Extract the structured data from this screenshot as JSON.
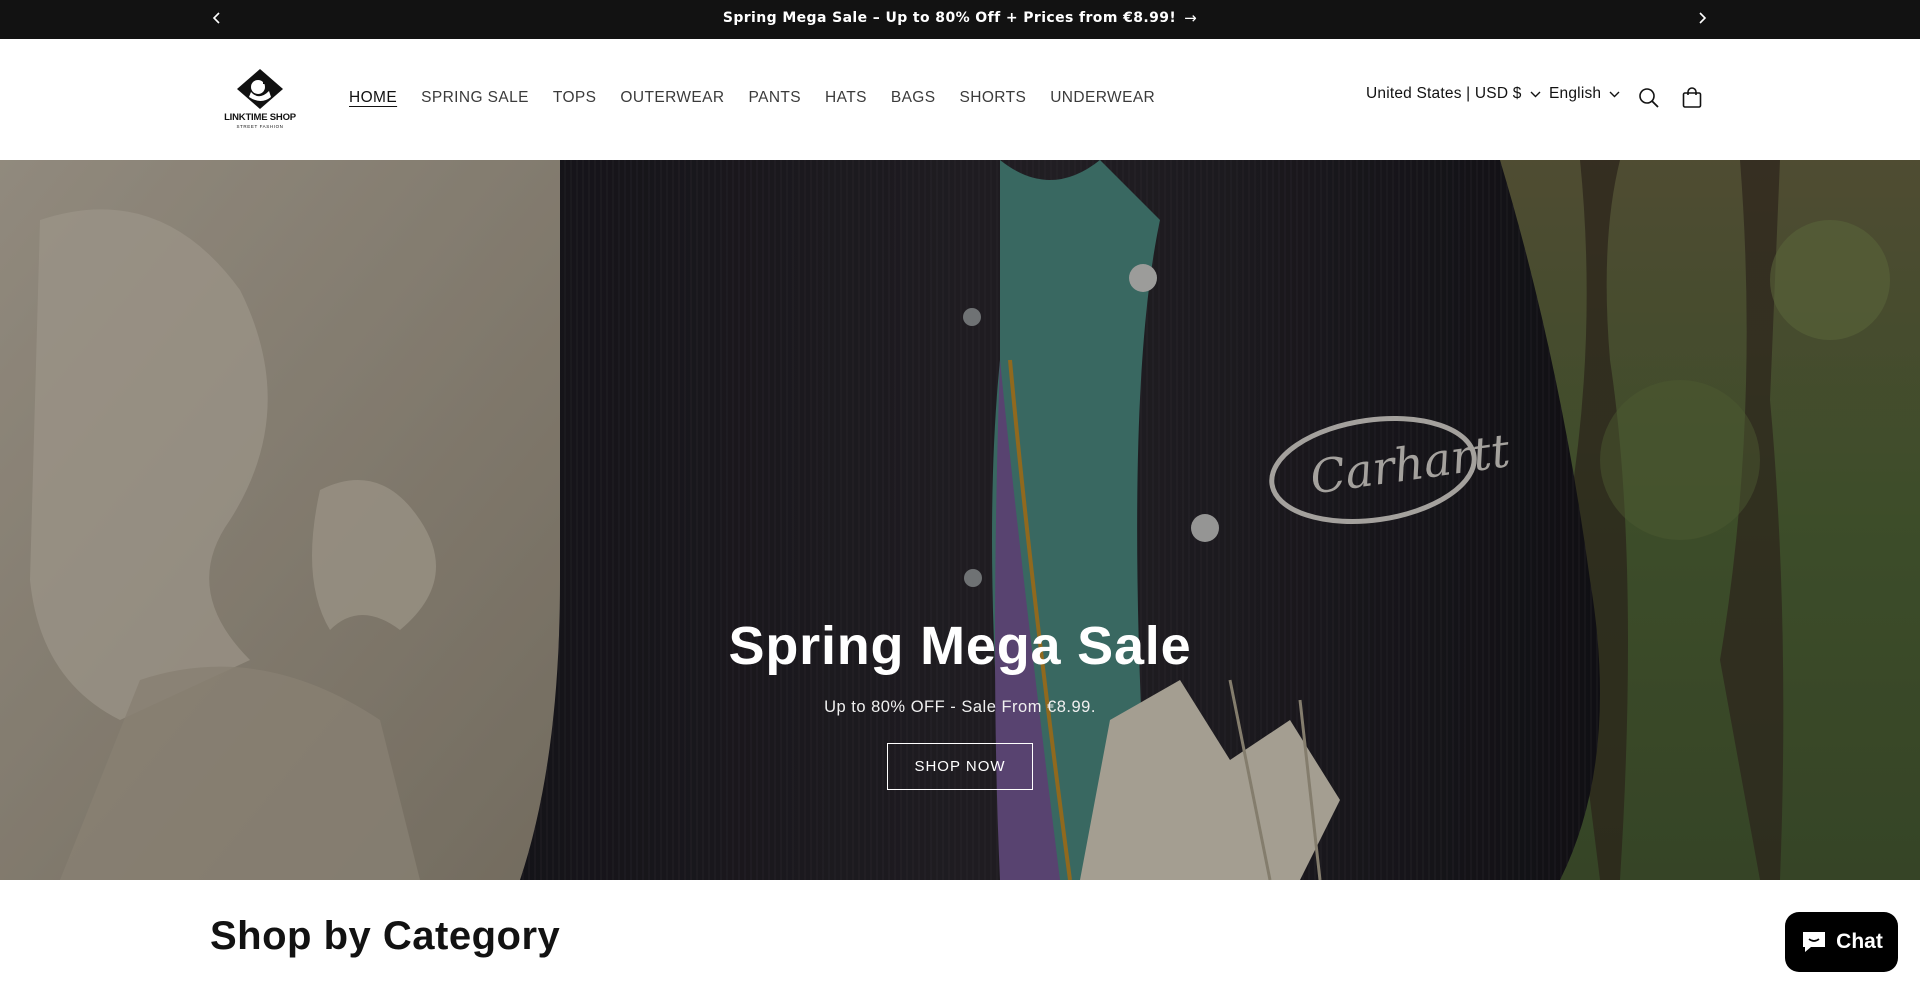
{
  "announcement": {
    "text": "Spring Mega Sale – Up to 80% Off + Prices from €8.99!",
    "arrow": "→"
  },
  "header": {
    "logo": {
      "name": "LINKTIME SHOP",
      "tagline": "STREET FASHION"
    },
    "menu": [
      {
        "label": "HOME",
        "active": true
      },
      {
        "label": "SPRING SALE"
      },
      {
        "label": "TOPS"
      },
      {
        "label": "OUTERWEAR"
      },
      {
        "label": "PANTS"
      },
      {
        "label": "HATS"
      },
      {
        "label": "BAGS"
      },
      {
        "label": "SHORTS"
      },
      {
        "label": "UNDERWEAR"
      }
    ],
    "country": "United States | USD $",
    "language": "English"
  },
  "hero": {
    "title": "Spring Mega Sale",
    "subtitle": "Up to 80% OFF - Sale From €8.99.",
    "button": "SHOP NOW",
    "patch_text": "Carhartt"
  },
  "category_section": {
    "title": "Shop by Category"
  },
  "chat": {
    "label": "Chat"
  },
  "icons": {
    "prev": "chevron-left-icon",
    "next": "chevron-right-icon",
    "search": "search-icon",
    "cart": "bag-icon",
    "chat": "chat-bubble-icon"
  }
}
